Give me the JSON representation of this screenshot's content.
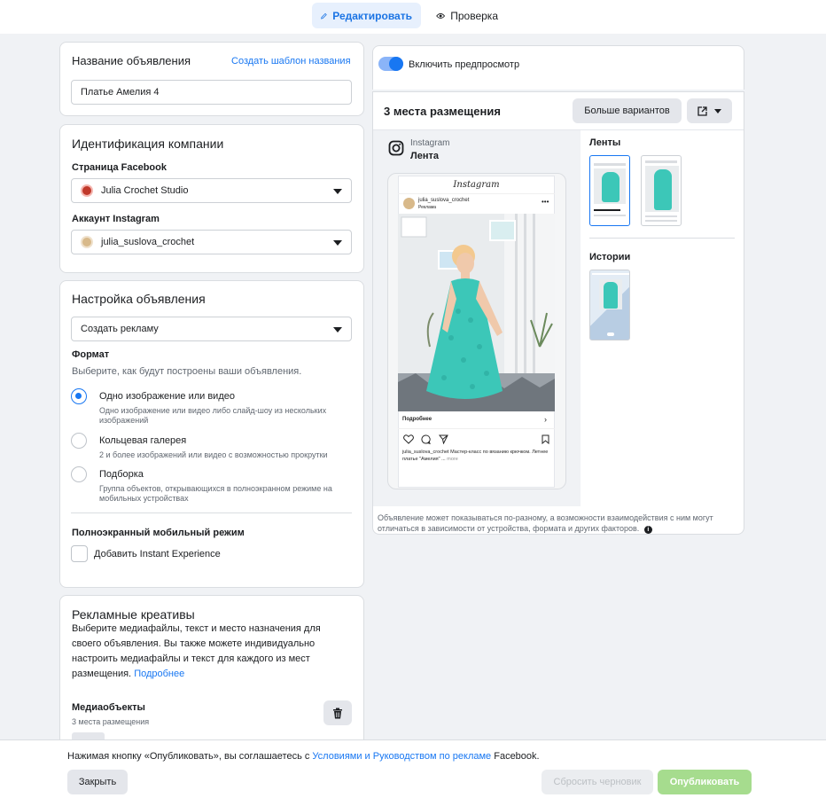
{
  "topbar": {
    "edit_label": "Редактировать",
    "check_label": "Проверка"
  },
  "ad_name": {
    "title": "Название объявления",
    "template_link": "Создать шаблон названия",
    "value": "Платье Амелия 4"
  },
  "identity": {
    "title": "Идентификация компании",
    "facebook_label": "Страница Facebook",
    "facebook_value": "Julia Crochet Studio",
    "instagram_label": "Аккаунт Instagram",
    "instagram_value": "julia_suslova_crochet"
  },
  "setup": {
    "title": "Настройка объявления",
    "select_value": "Создать рекламу",
    "format_label": "Формат",
    "format_desc": "Выберите, как будут построены ваши объявления.",
    "options": [
      {
        "title": "Одно изображение или видео",
        "desc": "Одно изображение или видео либо слайд-шоу из нескольких изображений",
        "selected": true
      },
      {
        "title": "Кольцевая галерея",
        "desc": "2 и более изображений или видео с возможностью прокрутки",
        "selected": false
      },
      {
        "title": "Подборка",
        "desc": "Группа объектов, открывающихся в полноэкранном режиме на мобильных устройствах",
        "selected": false
      }
    ],
    "fullscreen_label": "Полноэкранный мобильный режим",
    "instant_label": "Добавить Instant Experience"
  },
  "creatives": {
    "title": "Рекламные креативы",
    "desc": "Выберите медиафайлы, текст и место назначения для своего объявления. Вы также можете индивидуально настроить медиафайлы и текст для каждого из мест размещения.",
    "more_link": "Подробнее",
    "media_label": "Медиаобъекты",
    "media_sub": "3 места размещения"
  },
  "preview": {
    "toggle_label": "Включить предпросмотр",
    "toggle_on": true,
    "placements_title": "3 места размещения",
    "more_variants": "Больше вариантов",
    "platform": "Instagram",
    "placement": "Лента",
    "phone": {
      "app_logo": "Instagram",
      "username": "julia_suslova_crochet",
      "sponsored": "Реклама",
      "cta": "Подробнее",
      "caption_user": "julia_suslova_crochet",
      "caption_text": "Мастер-класс по вязанию крючком. Летнее платье \"Амелия\" ...",
      "caption_more": "more"
    },
    "feeds_label": "Ленты",
    "stories_label": "Истории",
    "disclaimer": "Объявление может показываться по-разному, а возможности взаимодействия с ним могут отличаться в зависимости от устройства, формата и других факторов."
  },
  "bottom": {
    "agreement_prefix": "Нажимая кнопку «Опубликовать», вы соглашаетесь с ",
    "agreement_link": "Условиями и Руководством по рекламе",
    "agreement_suffix": " Facebook.",
    "close_label": "Закрыть",
    "reset_label": "Сбросить черновик",
    "publish_label": "Опубликовать"
  },
  "colors": {
    "accent": "#1877f2",
    "publish_disabled": "#a6dc8e",
    "dress": "#3cc7b8"
  }
}
